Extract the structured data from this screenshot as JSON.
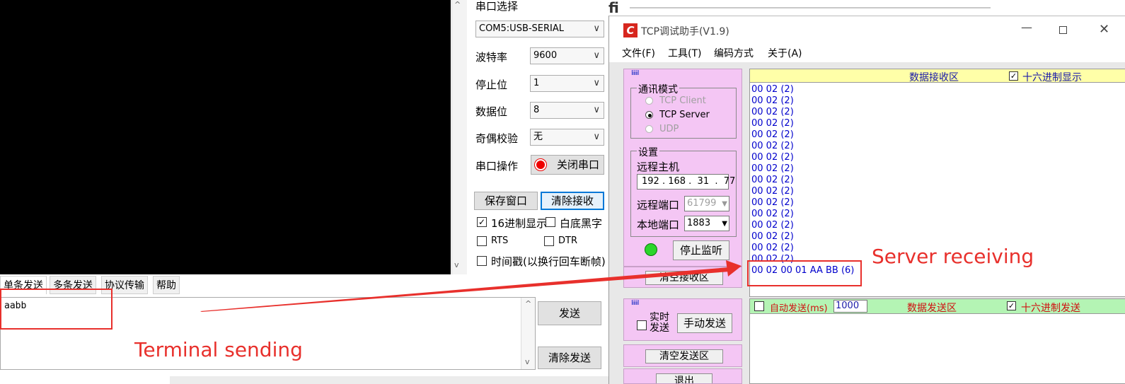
{
  "serial": {
    "port_label": "串口选择",
    "port_value": "COM5:USB-SERIAL",
    "baud_label": "波特率",
    "baud_value": "9600",
    "stop_label": "停止位",
    "stop_value": "1",
    "data_label": "数据位",
    "data_value": "8",
    "parity_label": "奇偶校验",
    "parity_value": "无",
    "op_label": "串口操作",
    "close_port": "关闭串口",
    "save_window": "保存窗口",
    "clear_recv": "清除接收",
    "hex_display": "16进制显示",
    "white_black": "白底黑字",
    "rts": "RTS",
    "dtr": "DTR",
    "timestamp": "时间戳(以换行回车断帧)",
    "tabs": [
      "单条发送",
      "多条发送",
      "协议传输",
      "帮助"
    ],
    "send_text": "aabb",
    "send_btn": "发送",
    "clear_send": "清除发送"
  },
  "tcp": {
    "title": "TCP调试助手(V1.9)",
    "menu": [
      "文件(F)",
      "工具(T)",
      "编码方式",
      "关于(A)"
    ],
    "logo_text": "liiiiil",
    "mode_title": "通讯模式",
    "modes": [
      "TCP Client",
      "TCP Server",
      "UDP"
    ],
    "settings_title": "设置",
    "remote_host_label": "远程主机",
    "remote_host": "192 . 168 .  31  .  77",
    "remote_port_label": "远程端口",
    "remote_port": "61799",
    "local_port_label": "本地端口",
    "local_port": "1883",
    "stop_listen": "停止监听",
    "clear_recv_area": "清空接收区",
    "recv_header": "数据接收区",
    "hex_display": "十六进制显示",
    "recv_lines": [
      "00 02  (2)",
      "00 02  (2)",
      "00 02  (2)",
      "00 02  (2)",
      "00 02  (2)",
      "00 02  (2)",
      "00 02  (2)",
      "00 02  (2)",
      "00 02  (2)",
      "00 02  (2)",
      "00 02  (2)",
      "00 02  (2)",
      "00 02  (2)",
      "00 02  (2)",
      "00 02  (2)",
      "00 02  (2)",
      "00 02 00 01 AA BB  (6)"
    ],
    "realtime_send": "实时发送",
    "manual_send": "手动发送",
    "clear_send_area": "清空发送区",
    "exit_label": "退出",
    "auto_send": "自动发送(ms)",
    "auto_interval": "1000",
    "send_header": "数据发送区",
    "hex_send": "十六进制发送"
  },
  "annotations": {
    "server": "Server receiving",
    "terminal": "Terminal sending"
  },
  "colors": {
    "annotation": "#e8302c",
    "pink_panel": "#f4c6f4",
    "header_yellow": "#ffffa8",
    "header_green": "#b4f4b4",
    "recv_text": "#0000cc"
  }
}
